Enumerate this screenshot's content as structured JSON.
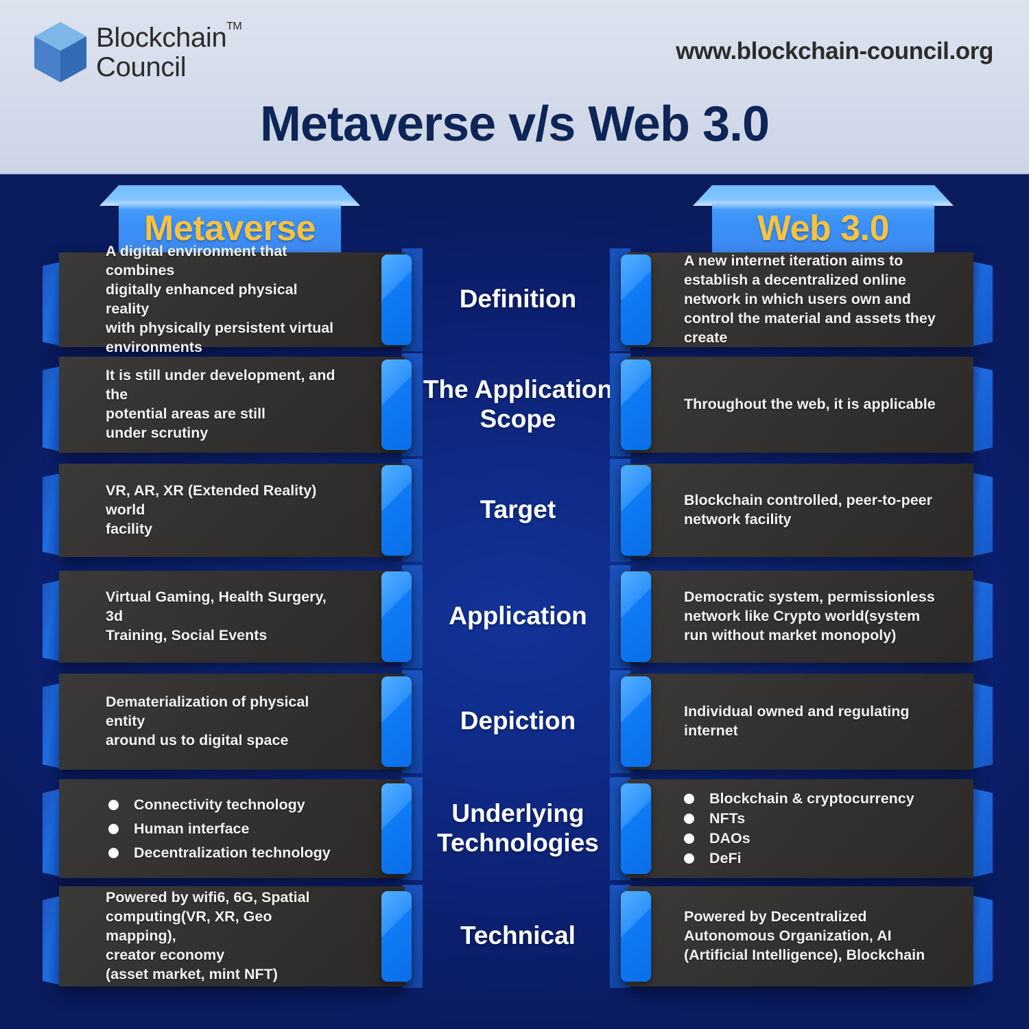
{
  "header": {
    "brand_line1": "Blockchain",
    "brand_line2": "Council",
    "trademark": "TM",
    "url": "www.blockchain-council.org",
    "title": "Metaverse v/s Web 3.0"
  },
  "columns": {
    "left_title": "Metaverse",
    "right_title": "Web 3.0"
  },
  "colors": {
    "page_background": "#0d2472",
    "header_background": "#d7deec",
    "title_color": "#0d2557",
    "column_header_blue": "#3a90f7",
    "column_title_gold": "#f5c243",
    "card_dark": "#34322f",
    "tab_blue": "#0f7bf5",
    "bullet_white": "#ffffff"
  },
  "rows": [
    {
      "label": "Definition",
      "left": {
        "type": "text",
        "text": "A digital environment that combines\ndigitally enhanced physical reality\nwith physically persistent virtual\nenvironments"
      },
      "right": {
        "type": "text",
        "text": "A new internet iteration aims to\nestablish a decentralized online\nnetwork in which users own and\ncontrol the material and assets they\ncreate"
      }
    },
    {
      "label": "The Application\nScope",
      "left": {
        "type": "text",
        "text": "It is still under development, and the\npotential areas are still\nunder scrutiny"
      },
      "right": {
        "type": "text",
        "text": "Throughout the web, it is applicable"
      }
    },
    {
      "label": "Target",
      "left": {
        "type": "text",
        "text": "VR, AR, XR (Extended Reality) world\nfacility"
      },
      "right": {
        "type": "text",
        "text": "Blockchain controlled, peer-to-peer\nnetwork facility"
      }
    },
    {
      "label": "Application",
      "left": {
        "type": "text",
        "text": "Virtual Gaming, Health Surgery, 3d\nTraining, Social Events"
      },
      "right": {
        "type": "text",
        "text": "Democratic system, permissionless\nnetwork like Crypto world(system\nrun without market monopoly)"
      }
    },
    {
      "label": "Depiction",
      "left": {
        "type": "text",
        "text": "Dematerialization of physical entity\naround us to digital space"
      },
      "right": {
        "type": "text",
        "text": "Individual owned and regulating\ninternet"
      }
    },
    {
      "label": "Underlying\nTechnologies",
      "left": {
        "type": "bullets",
        "items": [
          "Connectivity technology",
          "Human interface",
          "Decentralization technology"
        ]
      },
      "right": {
        "type": "bullets",
        "items": [
          "Blockchain & cryptocurrency",
          "NFTs",
          "DAOs",
          "DeFi"
        ]
      }
    },
    {
      "label": "Technical",
      "left": {
        "type": "text",
        "text": "Powered by wifi6, 6G, Spatial\ncomputing(VR, XR, Geo mapping),\ncreator economy\n(asset market, mint NFT)"
      },
      "right": {
        "type": "text",
        "text": "Powered by Decentralized\nAutonomous Organization, AI\n(Artificial Intelligence), Blockchain"
      }
    }
  ]
}
